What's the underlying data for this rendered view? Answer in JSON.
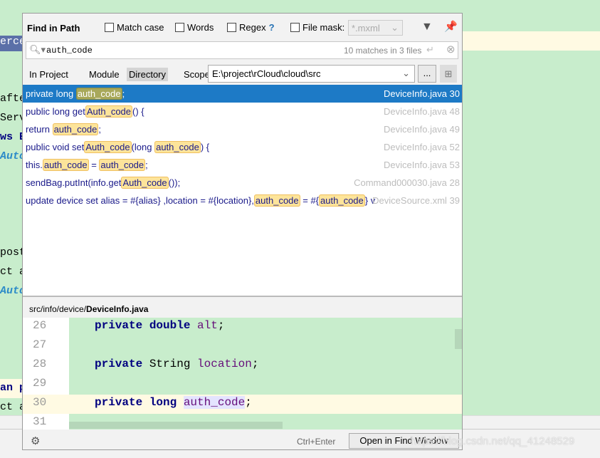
{
  "editor_bg": {
    "left_lines": [
      {
        "text": "erce",
        "style": "selected"
      },
      {
        "text": "afte"
      },
      {
        "text": "Serv"
      },
      {
        "text": "ws E",
        "style": "bold"
      },
      {
        "text": "Auto",
        "style": "italic"
      },
      {
        "text": "post"
      },
      {
        "text": "ct a"
      },
      {
        "text": "Auto",
        "style": "italic"
      },
      {
        "text": "an p",
        "style": "bold"
      },
      {
        "text": "ct a"
      }
    ]
  },
  "dialog": {
    "title": "Find in Path",
    "options": {
      "match_case": "Match case",
      "words": "Words",
      "regex": "Regex",
      "regex_help": "?",
      "file_mask": "File mask:",
      "file_mask_value": "*.mxml"
    },
    "search": {
      "query": "auth_code",
      "matches": "10 matches in 3 files"
    },
    "scope_tabs": [
      {
        "label": "In Project"
      },
      {
        "label": "Module"
      },
      {
        "label": "Directory",
        "active": true
      },
      {
        "label": "Scope"
      }
    ],
    "directory": "E:\\project\\rCloud\\cloud\\src",
    "browse_label": "...",
    "results": [
      {
        "segments": [
          [
            "private long ",
            0
          ],
          [
            "auth_code",
            1
          ],
          [
            ";",
            0
          ]
        ],
        "file": "DeviceInfo.java 30",
        "selected": true
      },
      {
        "segments": [
          [
            "public long get",
            0
          ],
          [
            "Auth_code",
            1
          ],
          [
            "() {",
            0
          ]
        ],
        "file": "DeviceInfo.java 48"
      },
      {
        "segments": [
          [
            "return ",
            0
          ],
          [
            "auth_code",
            1
          ],
          [
            ";",
            0
          ]
        ],
        "file": "DeviceInfo.java 49"
      },
      {
        "segments": [
          [
            "public void set",
            0
          ],
          [
            "Auth_code",
            1
          ],
          [
            "(long ",
            0
          ],
          [
            "auth_code",
            1
          ],
          [
            ") {",
            0
          ]
        ],
        "file": "DeviceInfo.java 52"
      },
      {
        "segments": [
          [
            "this.",
            0
          ],
          [
            "auth_code",
            1
          ],
          [
            " = ",
            0
          ],
          [
            "auth_code",
            1
          ],
          [
            ";",
            0
          ]
        ],
        "file": "DeviceInfo.java 53"
      },
      {
        "segments": [
          [
            "sendBag.putInt(info.get",
            0
          ],
          [
            "Auth_code",
            1
          ],
          [
            "());",
            0
          ]
        ],
        "file": "Command000030.java 28"
      },
      {
        "segments": [
          [
            "update device set alias = #{alias} ,location = #{location},",
            0
          ],
          [
            "auth_code",
            1
          ],
          [
            " = #{",
            0
          ],
          [
            "auth_code",
            1
          ],
          [
            "}  v",
            0
          ]
        ],
        "file": "DeviceSource.xml 39"
      }
    ],
    "preview_path": {
      "dir": "src/info/device/",
      "file": "DeviceInfo.java"
    },
    "preview_lines": [
      {
        "num": "26",
        "parts": [
          [
            "private double ",
            "kw"
          ],
          [
            "alt",
            "fld"
          ],
          [
            ";",
            ""
          ]
        ]
      },
      {
        "num": "27",
        "parts": []
      },
      {
        "num": "28",
        "parts": [
          [
            "private ",
            "kw"
          ],
          [
            "String ",
            ""
          ],
          [
            "location",
            "fld"
          ],
          [
            ";",
            ""
          ]
        ]
      },
      {
        "num": "29",
        "parts": []
      },
      {
        "num": "30",
        "parts": [
          [
            "private long ",
            "kw"
          ],
          [
            "auth_code",
            "fld hlp"
          ],
          [
            ";",
            ""
          ]
        ],
        "current": true
      },
      {
        "num": "31",
        "parts": []
      }
    ],
    "footer": {
      "shortcut": "Ctrl+Enter",
      "open_button": "Open in Find Window"
    }
  },
  "watermark": "https://blog.csdn.net/qq_41248529"
}
